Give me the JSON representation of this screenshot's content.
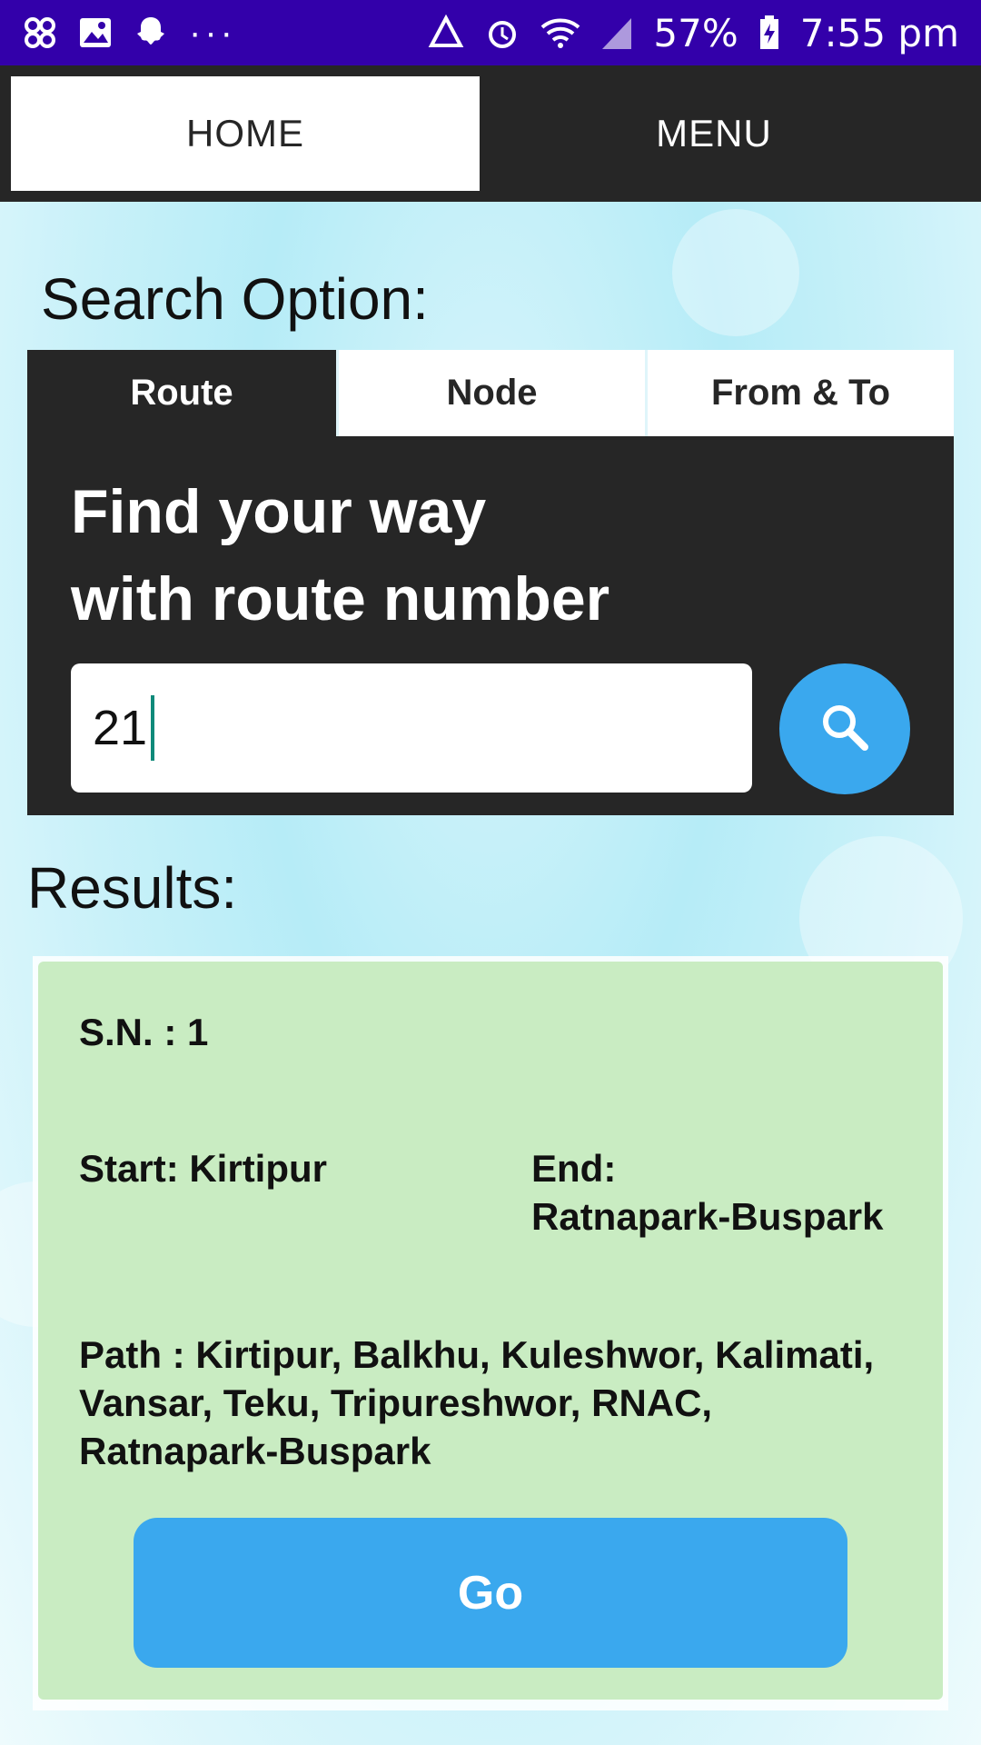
{
  "status_bar": {
    "left_icons": [
      "pinwheel-icon",
      "image-icon",
      "snapchat-icon",
      "more-dots-icon"
    ],
    "right_icons": [
      "data-saver-icon",
      "alarm-icon",
      "wifi-icon",
      "signal-icon",
      "battery-charging-icon"
    ],
    "battery": "57%",
    "time": "7:55 pm",
    "background_color": "#3300aa"
  },
  "navbar": {
    "home_label": "HOME",
    "menu_label": "MENU"
  },
  "search": {
    "section_title": "Search Option:",
    "tabs": [
      {
        "label": "Route",
        "active": true
      },
      {
        "label": "Node",
        "active": false
      },
      {
        "label": "From & To",
        "active": false
      }
    ],
    "headline_line1": "Find your way",
    "headline_line2": "with route number",
    "input_value": "21",
    "search_icon": "search-icon"
  },
  "results": {
    "title": "Results:",
    "items": [
      {
        "sn": "S.N. : 1",
        "start": "Start: Kirtipur",
        "end_label": "End:",
        "end_value": "Ratnapark-Buspark",
        "path_line1": "Path : Kirtipur, Balkhu, Kuleshwor, Kalimati,",
        "path_line2": "Vansar, Teku, Tripureshwor, RNAC,",
        "path_line3": "Ratnapark-Buspark",
        "go_label": "Go"
      }
    ]
  },
  "colors": {
    "accent_blue": "#3aa8ee",
    "card_green": "#c9ecc2",
    "dark_panel": "#262626"
  }
}
